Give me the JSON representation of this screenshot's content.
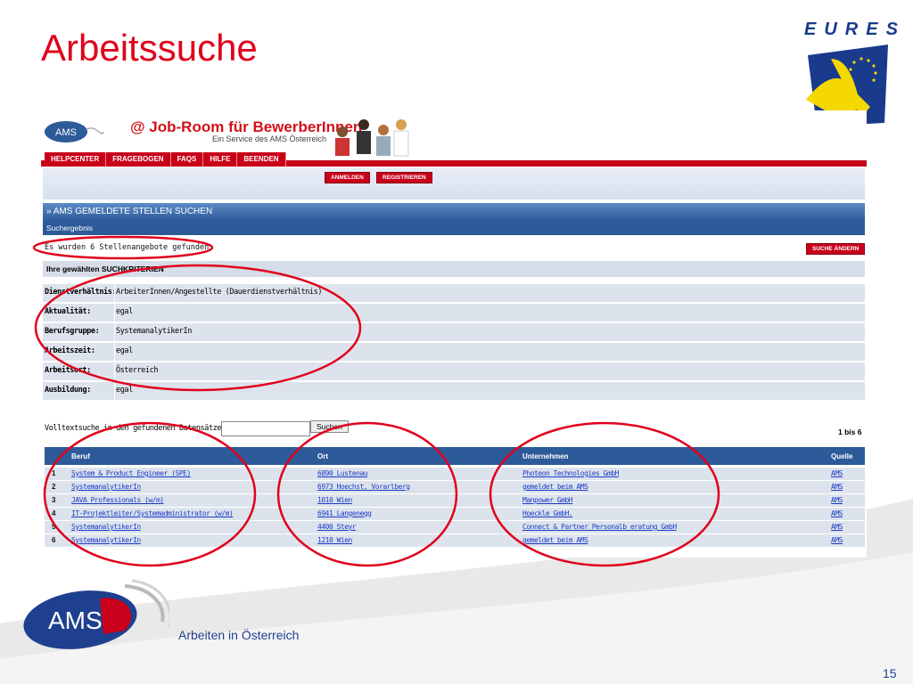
{
  "slide": {
    "title": "Arbeitssuche",
    "footer": "Arbeiten in Österreich",
    "page_number": "15",
    "brand_logo": "EURES",
    "ams_logo": "AMS"
  },
  "jobroom": {
    "logo_small": "AMS",
    "title": "@ Job-Room für BewerberInnen",
    "subtitle": "Ein Service des AMS Österreich",
    "nav": [
      "HELPCENTER",
      "FRAGEBOGEN",
      "FAQS",
      "HILFE",
      "BEENDEN"
    ],
    "buttons": {
      "login": "ANMELDEN",
      "register": "REGISTRIEREN",
      "change_search": "SUCHE ÄNDERN",
      "search": "Suchen"
    },
    "section_title": "» AMS GEMELDETE STELLEN SUCHEN",
    "sub_title": "Suchergebnis",
    "result_line": "Es wurden 6 Stellenangebote gefunden.",
    "criteria_title": "Ihre gewählten SUCHKRITERIEN",
    "criteria": [
      {
        "label": "Dienstverhältnis:",
        "value": "ArbeiterInnen/Angestellte (Dauerdienstverhältnis)"
      },
      {
        "label": "Aktualität:",
        "value": "egal"
      },
      {
        "label": "Berufsgruppe:",
        "value": "SystemanalytikerIn"
      },
      {
        "label": "Arbeitszeit:",
        "value": "egal"
      },
      {
        "label": "Arbeitsort:",
        "value": "Österreich"
      },
      {
        "label": "Ausbildung:",
        "value": "egal"
      }
    ],
    "fulltext_label": "Volltextsuche in den gefundenen Datensätzen:",
    "fulltext_value": "",
    "range": "1 bis 6",
    "columns": [
      "Beruf",
      "Ort",
      "Unternehmen",
      "Quelle"
    ],
    "results": [
      {
        "n": "1",
        "beruf": "System & Product Engineer (SPE)",
        "ort": "6890 Lustenau",
        "firma": "Photeon Technologies GmbH",
        "quelle": "AMS"
      },
      {
        "n": "2",
        "beruf": "SystemanalytikerIn",
        "ort": "6973 Hoechst, Vorarlberg",
        "firma": "gemeldet beim AMS",
        "quelle": "AMS"
      },
      {
        "n": "3",
        "beruf": "JAVA Professionals (w/m)",
        "ort": "1010 Wien",
        "firma": "Manpower GmbH",
        "quelle": "AMS"
      },
      {
        "n": "4",
        "beruf": "IT-Projektleiter/Systemadministrator (w/m)",
        "ort": "6941 Langenegg",
        "firma": "Hoeckle GmbH.",
        "quelle": "AMS"
      },
      {
        "n": "5",
        "beruf": "SystemanalytikerIn",
        "ort": "4400 Steyr",
        "firma": "Connect & Partner Personalb eratung GmbH",
        "quelle": "AMS"
      },
      {
        "n": "6",
        "beruf": "SystemanalytikerIn",
        "ort": "1210 Wien",
        "firma": "gemeldet beim AMS",
        "quelle": "AMS"
      }
    ]
  }
}
